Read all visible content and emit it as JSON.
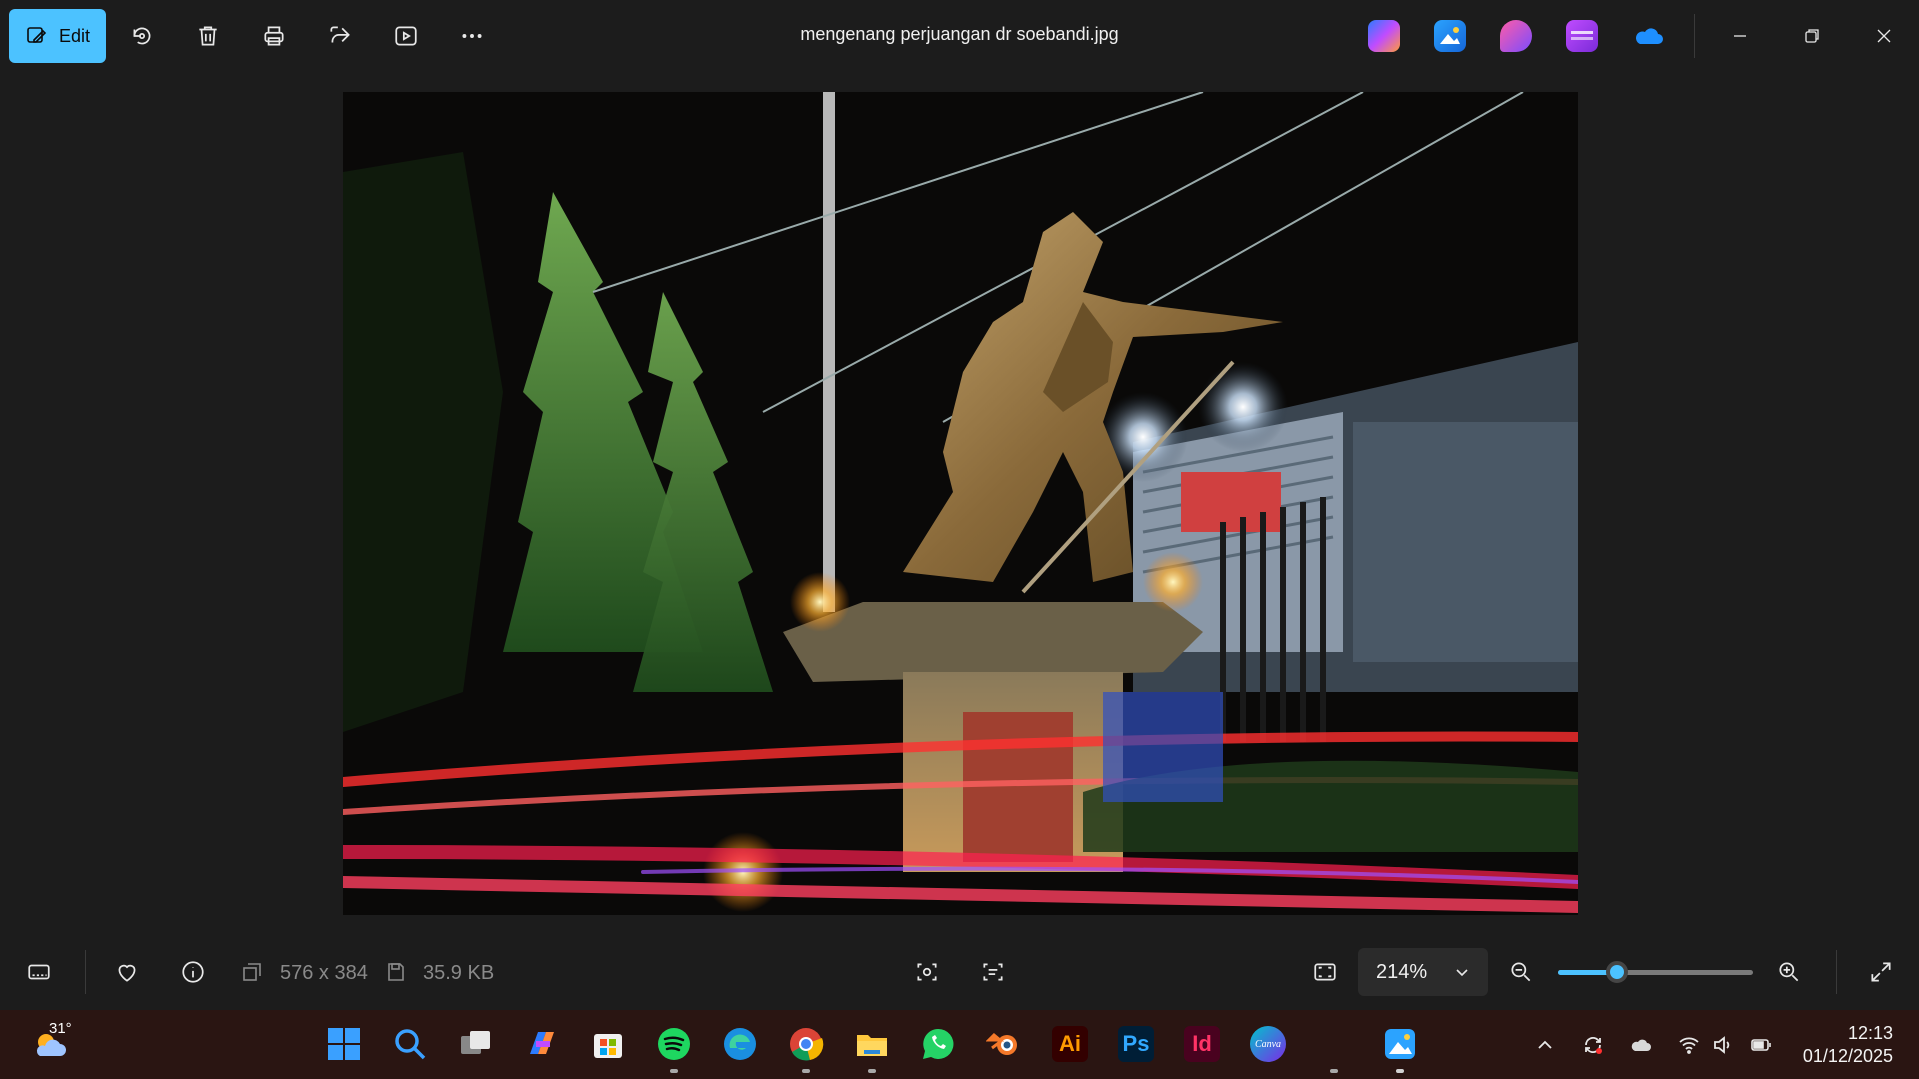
{
  "window": {
    "title": "mengenang perjuangan dr soebandi.jpg"
  },
  "toolbar": {
    "edit_label": "Edit",
    "icons": [
      "edit-image-icon",
      "rotate-icon",
      "delete-icon",
      "print-icon",
      "share-icon",
      "slideshow-icon",
      "more-icon"
    ]
  },
  "app_icons": [
    "copilot-icon",
    "photos-icon",
    "designer-icon",
    "clipchamp-icon",
    "onedrive-icon"
  ],
  "status": {
    "dimensions": "576 x 384",
    "file_size": "35.9 KB",
    "zoom": "214%",
    "zoom_level_fraction": 0.3
  },
  "taskbar": {
    "weather_temp": "31°",
    "apps": [
      "start",
      "search",
      "task-view",
      "copilot",
      "microsoft-store",
      "spotify",
      "edge",
      "chrome",
      "file-explorer",
      "whatsapp",
      "blender",
      "illustrator",
      "photoshop",
      "indesign",
      "canva",
      "photos"
    ],
    "ai_label": "Ai",
    "ps_label": "Ps",
    "id_label": "Id",
    "canva_label": "Canva",
    "clock_time": "12:13",
    "clock_date": "01/12/2025"
  },
  "colors": {
    "accent": "#4cc2ff",
    "background": "#1c1c1c",
    "taskbar": "#2a1512"
  }
}
